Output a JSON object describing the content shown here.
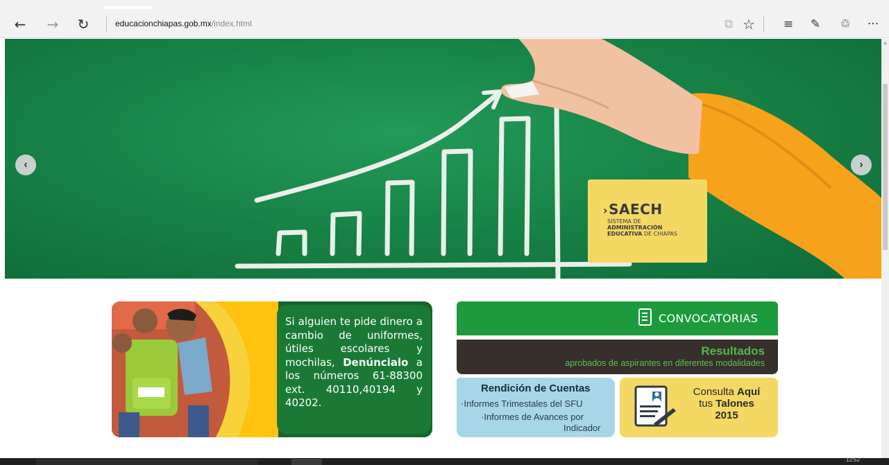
{
  "browser": {
    "back_icon": "arrow-left-icon",
    "back_glyph": "←",
    "forward_icon": "arrow-right-icon",
    "forward_glyph": "→",
    "refresh_icon": "refresh-icon",
    "refresh_glyph": "↻",
    "url_domain": "educacionchiapas.gob.mx",
    "url_path": "/index.html",
    "reading_view_icon": "book-icon",
    "reading_view_glyph": "⧉",
    "favorite_icon": "star-icon",
    "favorite_glyph": "☆",
    "hub_icon": "hub-icon",
    "hub_glyph": "≡",
    "note_icon": "web-note-icon",
    "note_glyph": "✎",
    "share_icon": "share-icon",
    "share_glyph": "♲",
    "more_icon": "more-icon",
    "more_glyph": "···"
  },
  "banner": {
    "prev_glyph": "‹",
    "next_glyph": "›",
    "saech": {
      "chev": "›",
      "name": "SAECH",
      "line1": "SISTEMA DE",
      "line2": "ADMINISTRACIÓN",
      "line3_bold": "EDUCATIVA",
      "line3_rest": " DE CHIAPAS"
    },
    "colors": {
      "chalkboard": "#188447",
      "saech_bg": "#f4d864",
      "sleeve": "#f7a21b"
    }
  },
  "denuncia": {
    "text_pre": "Si alguien te pide dinero a cambio de uniformes, útiles escolares y mochilas, ",
    "text_bold": "Denúncialo",
    "text_post": " a los números 61-88300 ext. 40110,40194 y 40202."
  },
  "convocatorias": {
    "label": "CONVOCATORIAS",
    "icon": "document-icon",
    "color": "#1c9a3c"
  },
  "resultados": {
    "title": "Resultados",
    "subtitle": "aprobados de aspirantes en diferentes modalidades"
  },
  "rendicion": {
    "title": "Rendición de Cuentas",
    "link1": "·Informes Trimestales del SFU",
    "link2": "·Informes de Avances por",
    "link3": "Indicador"
  },
  "talones": {
    "icon": "form-pen-icon",
    "line1_pre": "Consulta ",
    "line1_bold": "Aquí",
    "line2_pre": "tus ",
    "line2_bold": "Talones",
    "line3": "2015"
  },
  "taskbar": {
    "clock": "12:52"
  }
}
